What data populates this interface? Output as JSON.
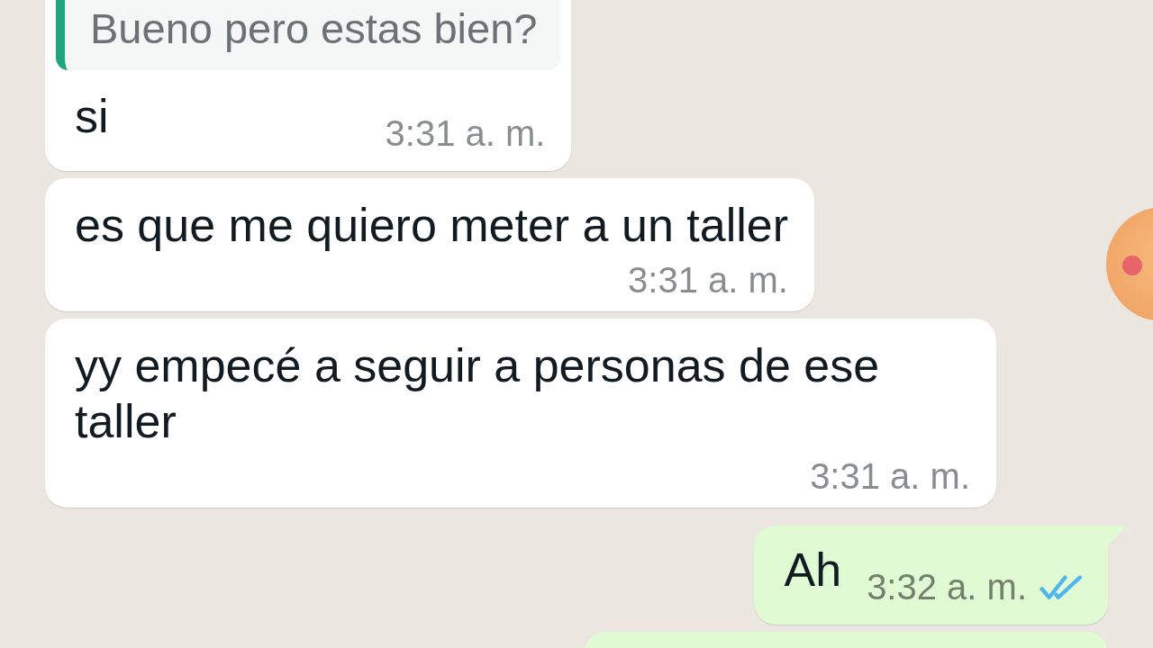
{
  "messages": [
    {
      "kind": "incoming",
      "quote": "Bueno pero estas bien?",
      "text": "si",
      "time": "3:31 a. m."
    },
    {
      "kind": "incoming",
      "text": "es que me quiero meter a un taller",
      "time": "3:31 a. m."
    },
    {
      "kind": "incoming",
      "text": "yy empecé a seguir a personas de ese taller",
      "time": "3:31 a. m."
    },
    {
      "kind": "outgoing",
      "text": "Ah",
      "time": "3:32 a. m.",
      "read": true
    },
    {
      "kind": "outgoing"
    }
  ]
}
